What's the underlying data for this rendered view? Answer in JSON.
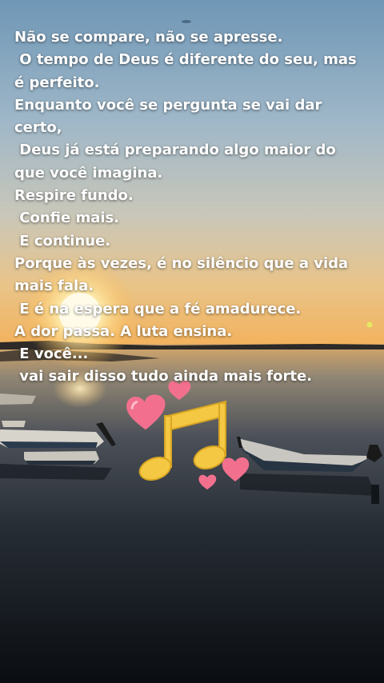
{
  "quote": {
    "lines": [
      "Não se compare, não se apresse.",
      " O tempo de Deus é diferente do seu, mas",
      "é perfeito.",
      "Enquanto você se pergunta se vai dar",
      "certo,",
      " Deus já está preparando algo maior do",
      "que você imagina.",
      "Respire fundo.",
      " Confie mais.",
      " E continue.",
      "Porque às vezes, é no silêncio que a vida",
      "mais fala.",
      " E é na espera que a fé amadurece.",
      "A dor passa. A luta ensina.",
      " E você...",
      " vai sair disso tudo ainda mais forte."
    ]
  },
  "colors": {
    "sky_top": "#6f97b6",
    "sky_mid": "#b7c6cf",
    "horizon": "#f0b35e",
    "sun": "#fff6d0",
    "water": "#1b222a",
    "heart": "#f2708e",
    "music_note": "#f4c842"
  },
  "stickers": [
    "heart-icon",
    "music-note-icon"
  ]
}
